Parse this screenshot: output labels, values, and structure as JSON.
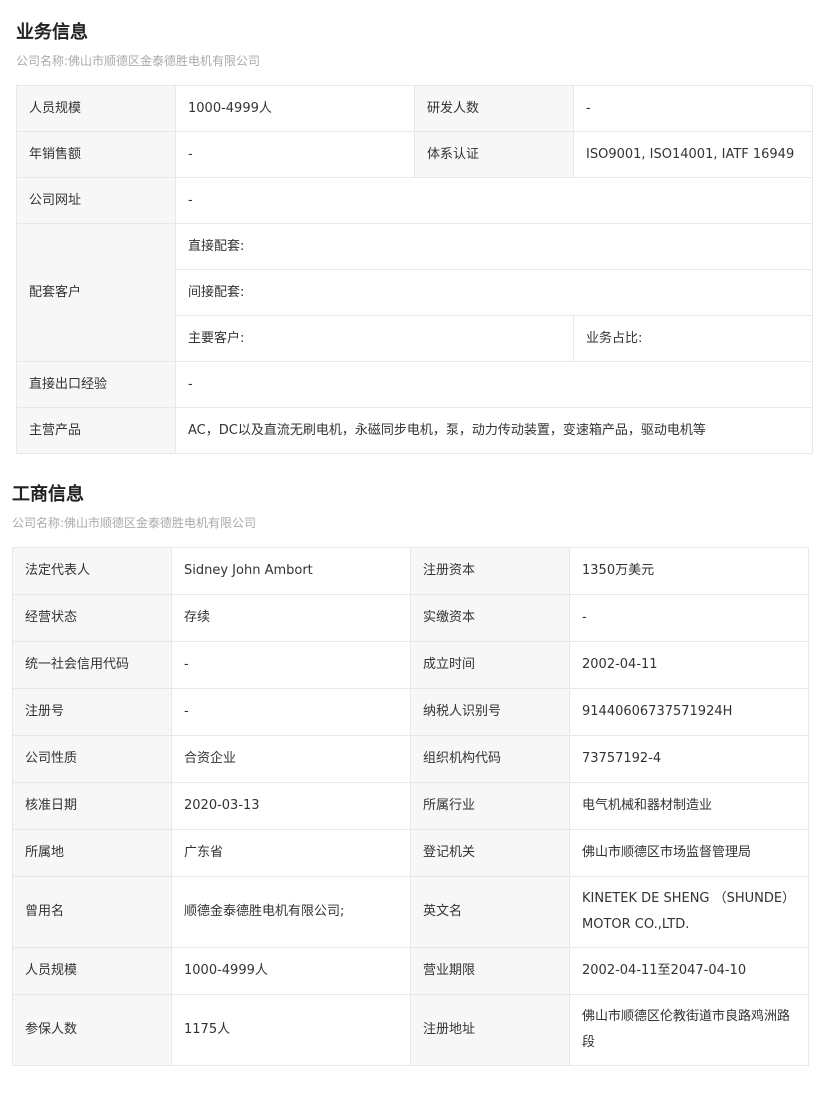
{
  "business": {
    "title": "业务信息",
    "company_line": "公司名称:佛山市顺德区金泰德胜电机有限公司",
    "staff_label": "人员规模",
    "staff_value": "1000-4999人",
    "rd_label": "研发人数",
    "rd_value": "-",
    "sales_label": "年销售额",
    "sales_value": "-",
    "cert_label": "体系认证",
    "cert_value": "ISO9001, ISO14001, IATF 16949",
    "website_label": "公司网址",
    "website_value": "-",
    "customers_label": "配套客户",
    "direct_label": "直接配套:",
    "indirect_label": "间接配套:",
    "main_customer_label": "主要客户:",
    "share_label": "业务占比:",
    "export_label": "直接出口经验",
    "export_value": "-",
    "products_label": "主营产品",
    "products_value": "AC，DC以及直流无刷电机，永磁同步电机，泵，动力传动装置，变速箱产品，驱动电机等"
  },
  "registration": {
    "title": "工商信息",
    "company_line": "公司名称:佛山市顺德区金泰德胜电机有限公司",
    "rows": [
      {
        "l1": "法定代表人",
        "v1": "Sidney John Ambort",
        "l2": "注册资本",
        "v2": "1350万美元"
      },
      {
        "l1": "经营状态",
        "v1": "存续",
        "l2": "实缴资本",
        "v2": "-"
      },
      {
        "l1": "统一社会信用代码",
        "v1": "-",
        "l2": "成立时间",
        "v2": "2002-04-11"
      },
      {
        "l1": "注册号",
        "v1": "-",
        "l2": "纳税人识别号",
        "v2": "91440606737571924H"
      },
      {
        "l1": "公司性质",
        "v1": "合资企业",
        "l2": "组织机构代码",
        "v2": "73757192-4"
      },
      {
        "l1": "核准日期",
        "v1": "2020-03-13",
        "l2": "所属行业",
        "v2": "电气机械和器材制造业"
      },
      {
        "l1": "所属地",
        "v1": "广东省",
        "l2": "登记机关",
        "v2": "佛山市顺德区市场监督管理局"
      },
      {
        "l1": "曾用名",
        "v1": "顺德金泰德胜电机有限公司;",
        "l2": "英文名",
        "v2": "KINETEK DE SHENG （SHUNDE） MOTOR CO.,LTD."
      },
      {
        "l1": "人员规模",
        "v1": "1000-4999人",
        "l2": "营业期限",
        "v2": "2002-04-11至2047-04-10"
      },
      {
        "l1": "参保人数",
        "v1": "1175人",
        "l2": "注册地址",
        "v2": "佛山市顺德区伦教街道市良路鸡洲路段"
      }
    ]
  }
}
